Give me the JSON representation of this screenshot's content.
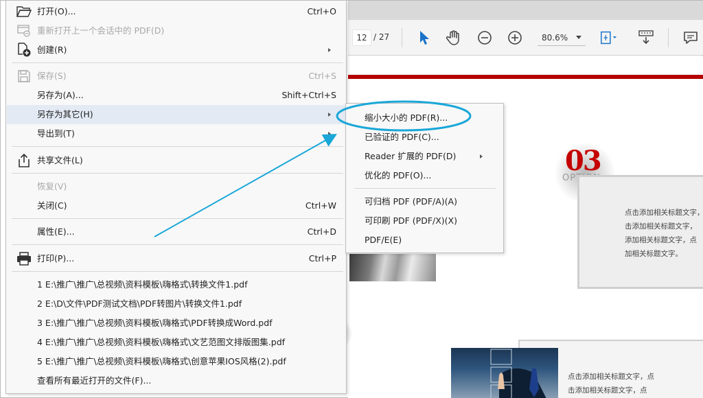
{
  "file_menu": {
    "items": [
      {
        "label": "打开(O)...",
        "shortcut": "Ctrl+O",
        "icon": "folder-open-icon",
        "disabled": false
      },
      {
        "label": "重新打开上一个会话中的 PDF(D)",
        "shortcut": "",
        "icon": "reopen-session-icon",
        "disabled": true
      },
      {
        "label": "创建(R)",
        "shortcut": "",
        "icon": "create-pdf-icon",
        "disabled": false,
        "submenu": true
      },
      {
        "label": "保存(S)",
        "shortcut": "Ctrl+S",
        "icon": "save-icon",
        "disabled": true
      },
      {
        "label": "另存为(A)...",
        "shortcut": "Shift+Ctrl+S",
        "icon": "",
        "disabled": false
      },
      {
        "label": "另存为其它(H)",
        "shortcut": "",
        "icon": "",
        "disabled": false,
        "submenu": true,
        "highlighted": true
      },
      {
        "label": "导出到(T)",
        "shortcut": "",
        "icon": "",
        "disabled": false,
        "submenu": true
      },
      {
        "label": "共享文件(L)",
        "shortcut": "",
        "icon": "share-icon",
        "disabled": false
      },
      {
        "label": "恢复(V)",
        "shortcut": "",
        "icon": "",
        "disabled": true
      },
      {
        "label": "关闭(C)",
        "shortcut": "Ctrl+W",
        "icon": "",
        "disabled": false
      },
      {
        "label": "属性(E)...",
        "shortcut": "Ctrl+D",
        "icon": "",
        "disabled": false
      },
      {
        "label": "打印(P)...",
        "shortcut": "Ctrl+P",
        "icon": "print-icon",
        "disabled": false
      }
    ],
    "recent_files": [
      "1 E:\\推广\\推广\\总视频\\资料模板\\嗨格式\\转换文件1.pdf",
      "2 E:\\D\\文件\\PDF测试文档\\PDF转图片\\转换文件1.pdf",
      "3 E:\\推广\\推广\\总视频\\资料模板\\嗨格式\\PDF转换成Word.pdf",
      "4 E:\\推广\\推广\\总视频\\资料模板\\嗨格式\\文艺范图文排版图集.pdf",
      "5 E:\\推广\\推广\\总视频\\资料模板\\嗨格式\\创意苹果IOS风格(2).pdf"
    ],
    "view_all_recent": "查看所有最近打开的文件(F)..."
  },
  "submenu": {
    "items": [
      {
        "label": "缩小大小的 PDF(R)...",
        "submenu": false,
        "circled": true
      },
      {
        "label": "已验证的 PDF(C)...",
        "submenu": false
      },
      {
        "label": "Reader 扩展的 PDF(D)",
        "submenu": true
      },
      {
        "label": "优化的 PDF(O)...",
        "submenu": false
      },
      {
        "label": "可归档 PDF (PDF/A)(A)",
        "submenu": false
      },
      {
        "label": "可印刷 PDF (PDF/X)(X)",
        "submenu": false
      },
      {
        "label": "PDF/E(E)",
        "submenu": false
      }
    ]
  },
  "toolbar": {
    "page_current": "12",
    "page_total": "/ 27",
    "zoom": "80.6%",
    "icons": [
      "select-arrow-icon",
      "hand-tool-icon",
      "zoom-out-icon",
      "zoom-in-icon",
      "fit-page-icon",
      "scroll-mode-icon",
      "comment-icon"
    ]
  },
  "document": {
    "number": "03",
    "option_word": "OPTION",
    "card1_text": "点击添加相关标题文字，\n击添加相关标题文字，\n添加相关标题文字，点\n加相关标题文字。",
    "card2_text": "点击添加相关标题文字，点\n击添加相关标题文字，点"
  },
  "colors": {
    "accent_blue": "#1aa7d8",
    "doc_red": "#b50000",
    "menu_highlight": "#e3eaf4"
  }
}
